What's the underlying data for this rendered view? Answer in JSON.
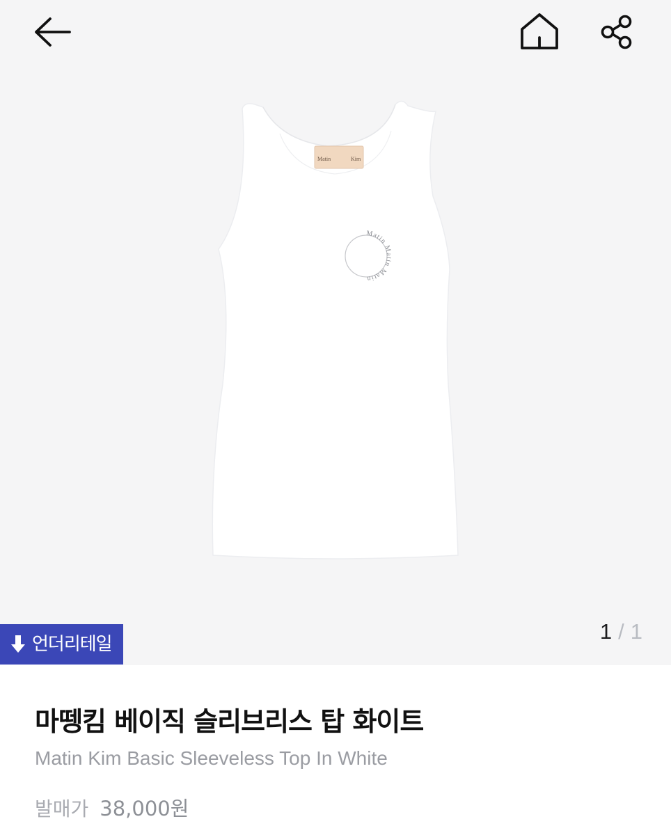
{
  "header": {
    "back_icon": "arrow-left-icon",
    "home_icon": "home-icon",
    "share_icon": "share-icon"
  },
  "gallery": {
    "current": "1",
    "separator": "/",
    "total": "1",
    "image_alt": "white sleeveless tank top with Matin Kim label and circular logo print"
  },
  "badge": {
    "icon": "arrow-down-icon",
    "label": "언더리테일",
    "color": "#3b47b7"
  },
  "product": {
    "title_ko": "마뗑킴 베이직 슬리브리스 탑 화이트",
    "title_en": "Matin Kim Basic Sleeveless Top In White",
    "price_label": "발매가",
    "price": "38,000원",
    "logo_tag_left": "Matin",
    "logo_tag_right": "Kim",
    "logo_ring_text": "Matin Matin Matin"
  }
}
